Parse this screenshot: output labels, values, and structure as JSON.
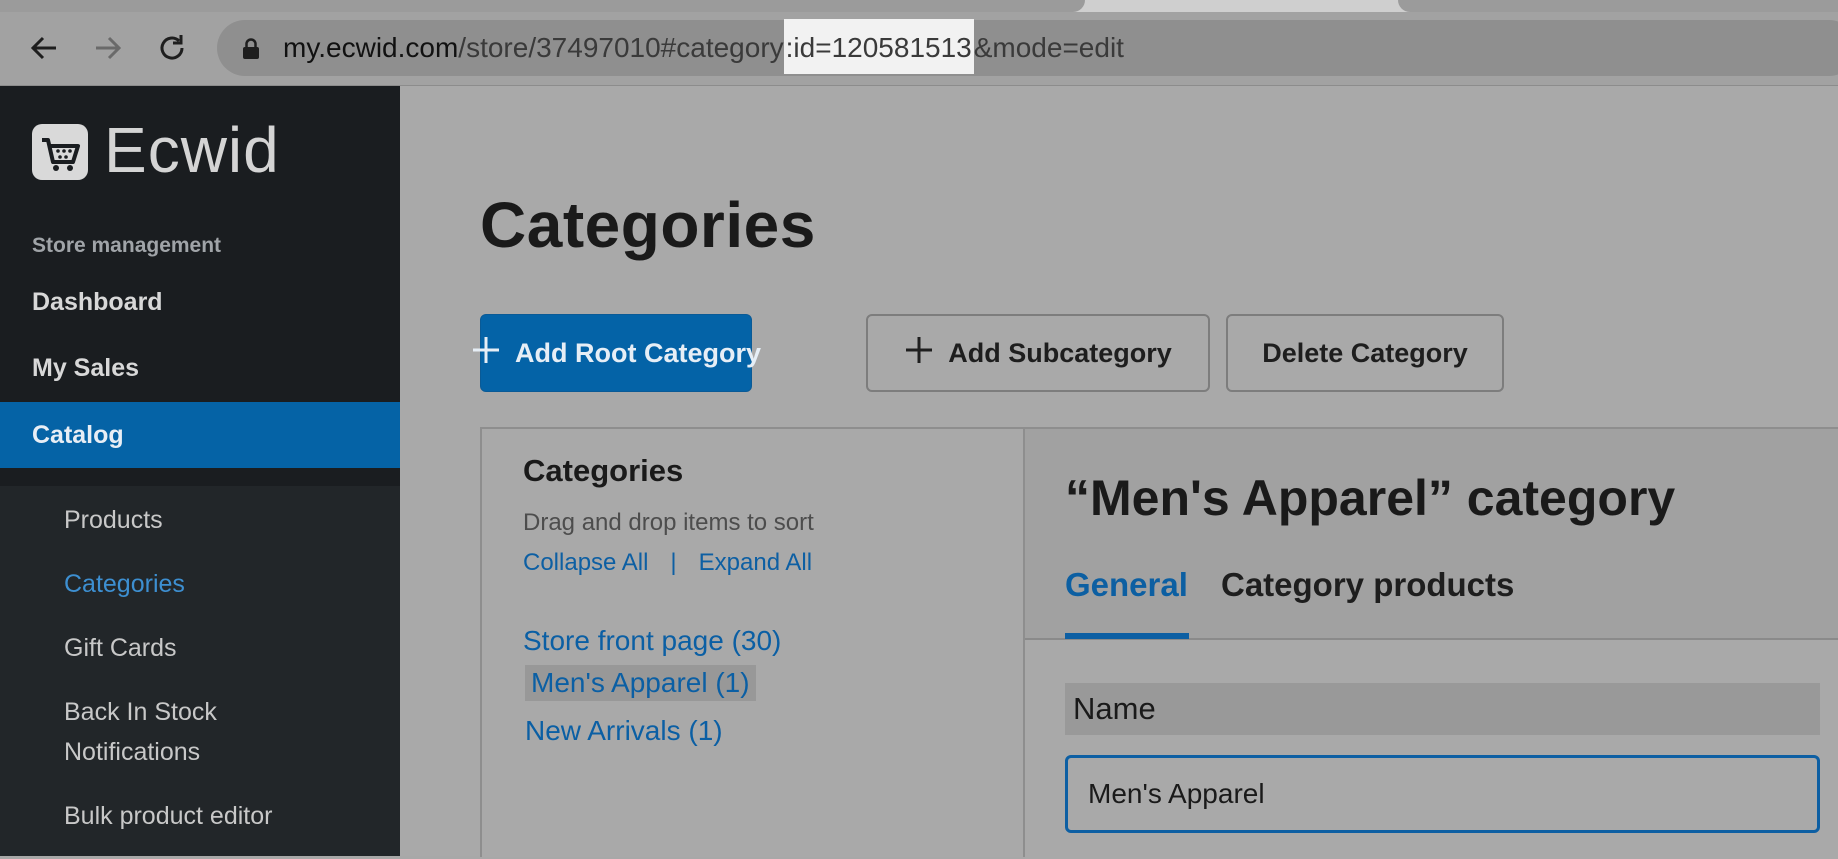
{
  "browser": {
    "url_host": "my.ecwid.com",
    "url_path_before": "/store/37497010#category",
    "url_highlight": ":id=120581513",
    "url_path_after": "&mode=edit"
  },
  "sidebar": {
    "logo_text": "Ecwid",
    "section_label": "Store management",
    "items": [
      {
        "label": "Dashboard"
      },
      {
        "label": "My Sales"
      },
      {
        "label": "Catalog",
        "active": true
      }
    ],
    "sub_items": [
      {
        "label": "Products"
      },
      {
        "label": "Categories",
        "active": true
      },
      {
        "label": "Gift Cards"
      },
      {
        "label": "Back In Stock"
      },
      {
        "label": "Notifications"
      },
      {
        "label": "Bulk product editor"
      }
    ]
  },
  "main": {
    "title": "Categories",
    "buttons": {
      "add_root": "Add Root Category",
      "add_sub": "Add Subcategory",
      "delete": "Delete Category"
    },
    "tree_panel": {
      "heading": "Categories",
      "hint": "Drag and drop items to sort",
      "collapse_all": "Collapse All",
      "separator": "|",
      "expand_all": "Expand All",
      "items": [
        {
          "label": "Store front page (30)"
        },
        {
          "label": "Men's Apparel (1)",
          "selected": true
        },
        {
          "label": "New Arrivals (1)"
        }
      ]
    },
    "editor": {
      "title": "“Men's Apparel” category",
      "tabs": [
        {
          "label": "General",
          "active": true
        },
        {
          "label": "Category products"
        }
      ],
      "name_label": "Name",
      "name_value": "Men's Apparel"
    }
  },
  "colors": {
    "accent": "#0463a7",
    "sidebar_bg": "#1a1d20",
    "link": "#0d5fa3"
  }
}
